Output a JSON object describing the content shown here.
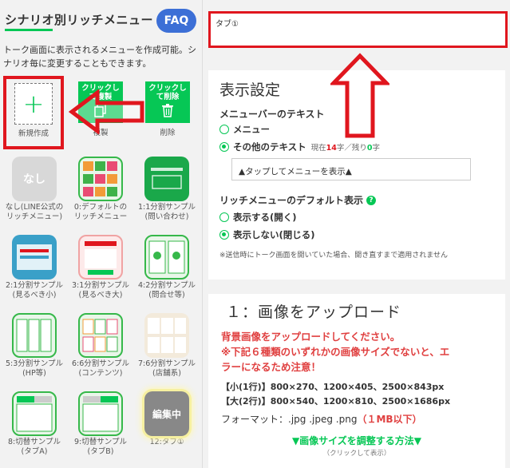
{
  "left": {
    "title": "シナリオ別リッチメニュー",
    "faq": "FAQ",
    "description": "トーク画面に表示されるメニューを作成可能。シナリオ毎に変更することもできます。",
    "new_label": "新規作成",
    "copy_button": "クリックして複製",
    "copy_label": "複製",
    "delete_button": "クリックして削除",
    "delete_label": "削除",
    "tiles": [
      {
        "thumb": "なし",
        "label": "なし(LINE公式の\nリッチメニュー)"
      },
      {
        "thumb": "",
        "label": "0:デフォルトの\nリッチメニュー"
      },
      {
        "thumb": "",
        "label": "1:1分割サンプル\n(問い合わせ)"
      },
      {
        "thumb": "",
        "label": "2:1分割サンプル\n(見るべき小)"
      },
      {
        "thumb": "",
        "label": "3:1分割サンプル\n(見るべき大)"
      },
      {
        "thumb": "",
        "label": "4:2分割サンプル\n(問合せ等)"
      },
      {
        "thumb": "",
        "label": "5:3分割サンプル\n(HP等)"
      },
      {
        "thumb": "",
        "label": "6:6分割サンプル\n(コンテンツ)"
      },
      {
        "thumb": "",
        "label": "7:6分割サンプル\n(店舗系)"
      },
      {
        "thumb": "",
        "label": "8:切替サンプル\n(タブA)"
      },
      {
        "thumb": "",
        "label": "9:切替サンプル\n(タブB)"
      },
      {
        "thumb": "編集中",
        "label": "12:タブ①"
      }
    ]
  },
  "right": {
    "tab_name": "タブ①",
    "display_settings": {
      "heading": "表示設定",
      "menubar_text_label": "メニューバーのテキスト",
      "option_menu": "メニュー",
      "option_other": "その他のテキスト",
      "counter_prefix": "現在",
      "counter_current": "14",
      "counter_unit": "字／残り",
      "counter_remaining": "0",
      "counter_suffix": "字",
      "menu_text_value": "▲タップしてメニューを表示▲",
      "default_display_label": "リッチメニューのデフォルト表示",
      "help_icon": "?",
      "option_show": "表示する(開く)",
      "option_hide": "表示しない(閉じる)",
      "note": "※送信時にトーク画面を開いていた場合、開き直すまで適用されません"
    },
    "upload": {
      "heading": "１：画像をアップロード",
      "warn1": "背景画像をアップロードしてください。",
      "warn2": "※下記６種類のいずれかの画像サイズでないと、エ",
      "warn3": "ラーになるため注意！",
      "small_sizes": "【小(1行)】800×270、1200×405、2500×843px",
      "large_sizes": "【大(2行)】800×540、1200×810、2500×1686px",
      "format_label": "フォーマット：.jpg .jpeg .png",
      "format_limit": "（１MB以下）",
      "adjust_link": "▼画像サイズを調整する方法▼",
      "adjust_sub": "（クリックして表示）"
    }
  },
  "colors": {
    "accent_green": "#06c755",
    "highlight_red": "#e0161e",
    "faq_blue": "#3c6fd6",
    "warning_red": "#e04040"
  }
}
